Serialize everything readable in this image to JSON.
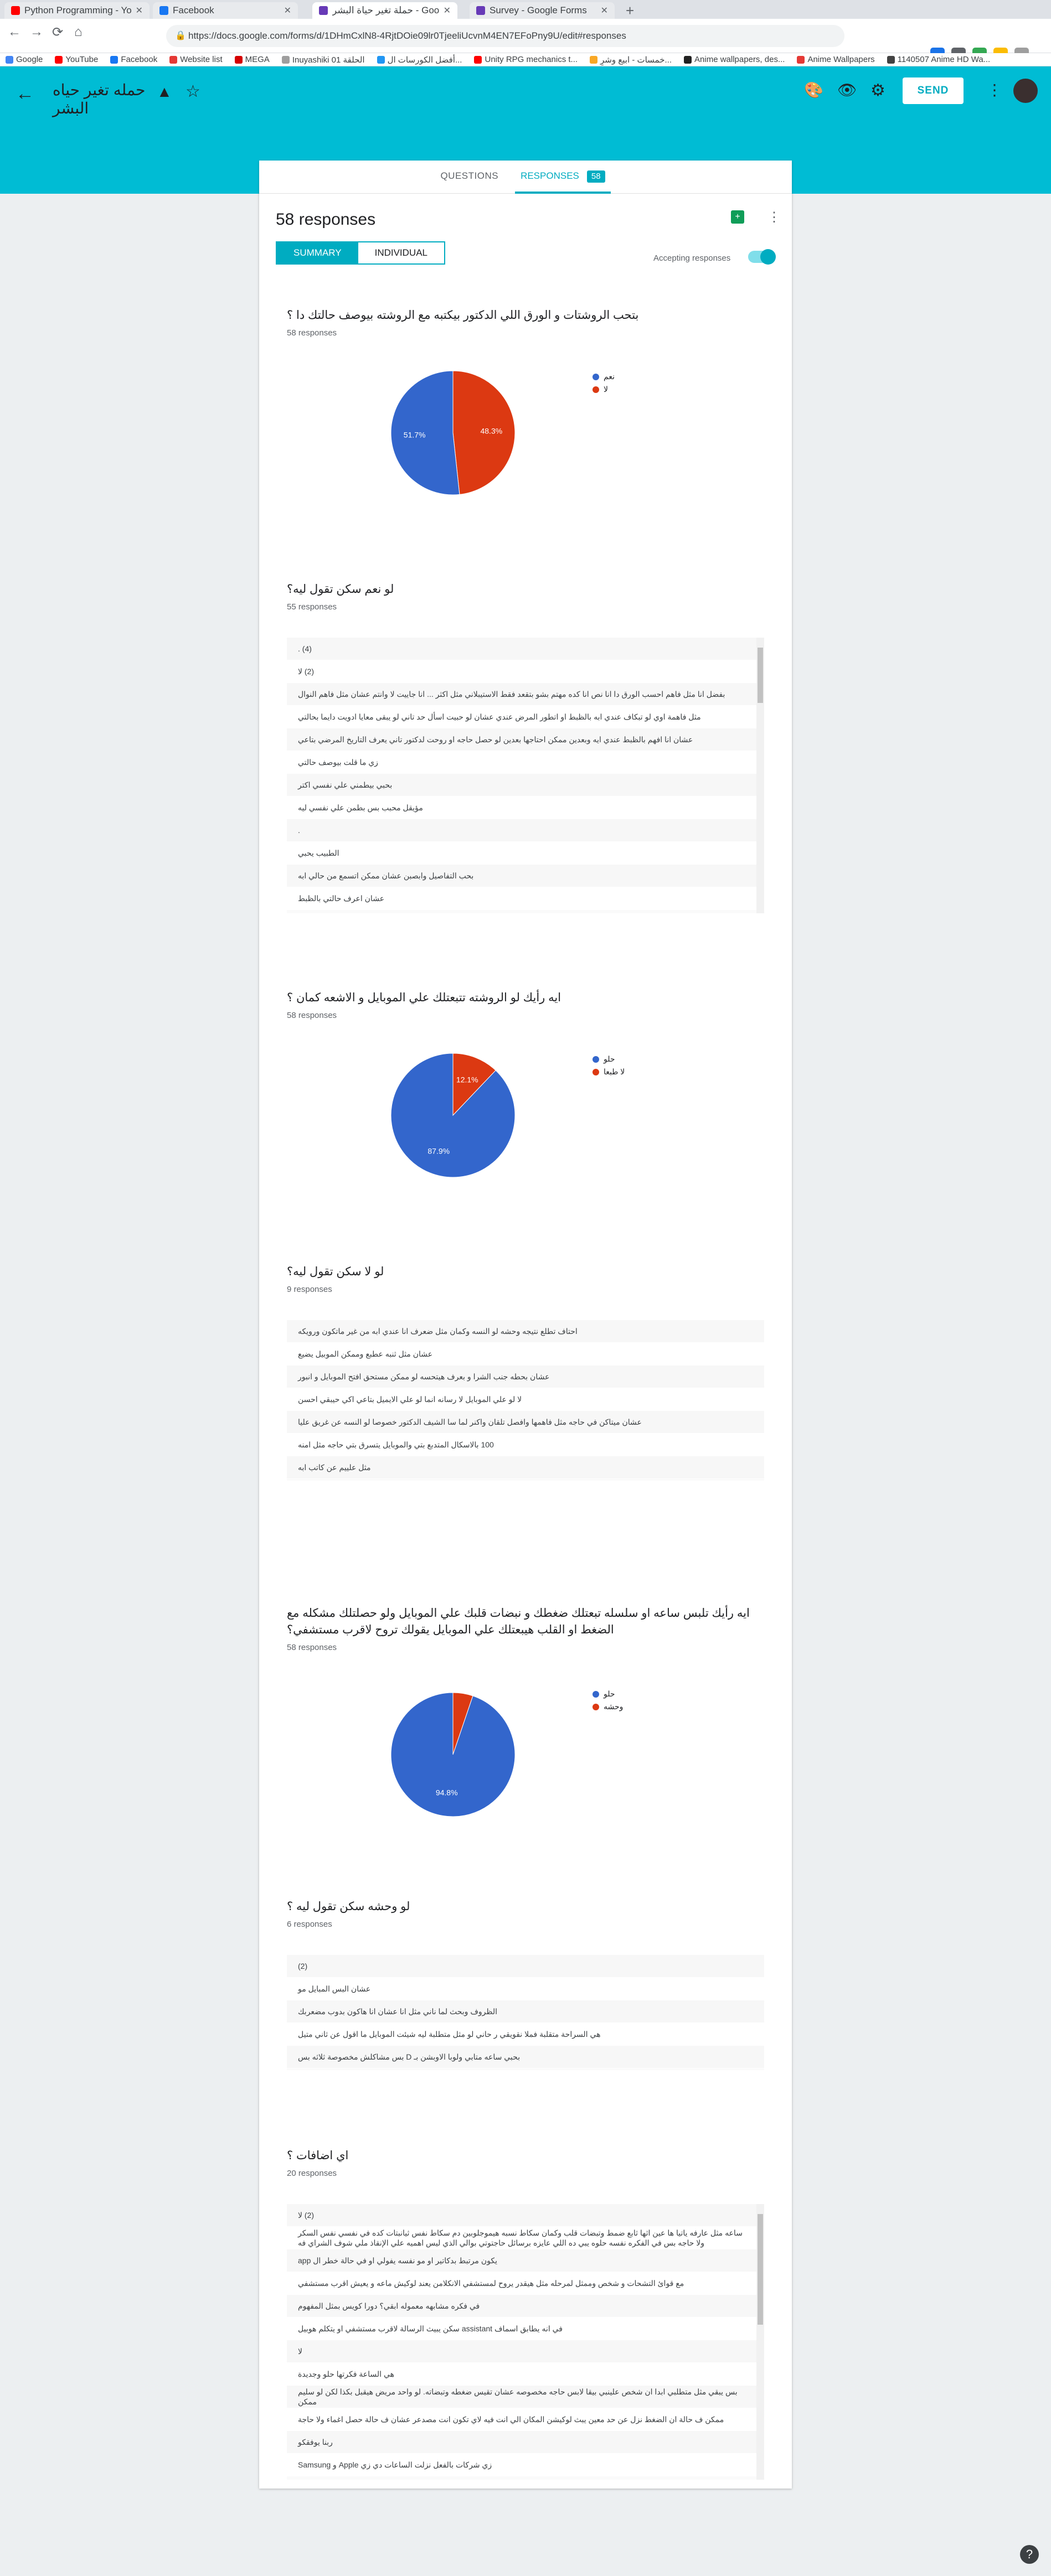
{
  "browser": {
    "tabs": [
      {
        "title": "Python Programming - YouTub",
        "color": "#ff0000"
      },
      {
        "title": "Facebook",
        "color": "#1877f2"
      },
      {
        "title": "حملة تغير حياة البشر - Google Forms",
        "color": "#673ab7"
      },
      {
        "title": "Survey - Google Forms",
        "color": "#673ab7"
      }
    ],
    "url": "https://docs.google.com/forms/d/1DHmCxlN8-4RjtDOie09lr0TjeeliUcvnM4EN7EFoPny9U/edit#responses",
    "bookmarks": [
      {
        "label": "Google",
        "color": "#4285f4"
      },
      {
        "label": "YouTube",
        "color": "#ff0000"
      },
      {
        "label": "Facebook",
        "color": "#1877f2"
      },
      {
        "label": "Website list",
        "color": "#e53935"
      },
      {
        "label": "MEGA",
        "color": "#d50000"
      },
      {
        "label": "Inuyashiki 01 الحلقة",
        "color": "#9e9e9e"
      },
      {
        "label": "أفضل الكورسات ال...",
        "color": "#2196f3"
      },
      {
        "label": "Unity RPG mechanics t...",
        "color": "#ff0000"
      },
      {
        "label": "خمسات - ابيع وشرِ...",
        "color": "#f9a825"
      },
      {
        "label": "Anime wallpapers, des...",
        "color": "#212121"
      },
      {
        "label": "Anime Wallpapers",
        "color": "#e53935"
      },
      {
        "label": "1140507 Anime HD Wa...",
        "color": "#424242"
      }
    ]
  },
  "appbar": {
    "form_title": "حمله تغير حياه البشر",
    "send_label": "SEND"
  },
  "tabs": {
    "questions": "QUESTIONS",
    "responses": "RESPONSES",
    "badge": "58"
  },
  "header": {
    "count_title": "58 responses",
    "summary": "SUMMARY",
    "individual": "INDIVIDUAL",
    "accepting": "Accepting responses"
  },
  "questions": [
    {
      "title": "بتحب الروشتات و الورق اللي الدكتور بيكتبه مع الروشته بيوصف حالتك دا ؟",
      "count": "58 responses"
    },
    {
      "title": "لو نعم سكن تقول ليه؟",
      "count": "55 responses"
    },
    {
      "title": "ايه رأيك لو الروشته تتبعتلك علي الموبايل و الاشعه كمان ؟",
      "count": "58 responses"
    },
    {
      "title": "لو لا سكن تقول ليه؟",
      "count": "9 responses"
    },
    {
      "title": "ايه رأيك تلبس ساعه او سلسله تبعتلك ضغطك و نبضات قلبك علي الموبايل ولو حصلتلك مشكله مع الضغط او القلب هيبعتلك علي الموبايل يقولك تروح لاقرب مستشفي؟",
      "count": "58 responses"
    },
    {
      "title": "لو وحشه سكن تقول ليه ؟",
      "count": "6 responses"
    },
    {
      "title": "اي اضافات ؟",
      "count": "20 responses"
    }
  ],
  "chart_data": [
    {
      "type": "pie",
      "labels": [
        "نعم",
        "لا"
      ],
      "values": [
        51.7,
        48.3
      ],
      "colors": [
        "#3366cc",
        "#dc3912"
      ]
    },
    {
      "type": "pie",
      "labels": [
        "حلو",
        "لا طبعا"
      ],
      "values": [
        87.9,
        12.1
      ],
      "colors": [
        "#3366cc",
        "#dc3912"
      ]
    },
    {
      "type": "pie",
      "labels": [
        "حلو",
        "وحشه"
      ],
      "values": [
        94.8,
        5.2
      ],
      "colors": [
        "#3366cc",
        "#dc3912"
      ]
    }
  ],
  "answers_q2": [
    "(4) .",
    "(2) لا",
    "بفضل انا مثل فاهم احسب الورق دا انا نص انا كده مهتم بشو بتقعد فقط الاستيبلاني مثل اكثر ... انا جاييت لا وانتم عشان مثل فاهم النوال",
    "مثل فاهمة اوي لو تبكاف عندي ابه بالظبط او اتطور المرض عندي عشان لو حبيت اسأل حد تاني لو يبقى معايا ادويت دايما بحالتي",
    "عشان انا افهم بالظبط عندي ايه وبعدين ممكن احتاجها بعدين لو حصل حاجه او روحت لدكتور تاني يعرف التاريخ المرضي بتاعي",
    "زي ما قلت بيوصف حالتي",
    "بحبي بيطمني علي نفسي اكتر",
    "مؤيقل محبب بس بطمن علي نفسي ليه",
    ".",
    "الطبيب يحبي",
    "بحب التفاصيل وابصبن عشان ممكن اتسمع من حالي ابه",
    "عشان اعرف حالتي بالظبط"
  ],
  "answers_q4": [
    "احتاف تطلع نتيجه وحشه لو النسه وكمان مثل ضعرف انا عندي ابه من غير ماتكون ورويكه",
    "عشان مثل ثنبه عطبع وممكن الموبيل يضيع",
    "عشان بحطه جنب الشرا و بعرف هيتحسه لو ممكن مستحق افتح الموبايل و انبور",
    "لا لو علي الموبايل لا رسانه انما لو علي الايميل بتاعي اكي حيبقي احسن",
    "عشان ميتاكن في حاجه مثل فاهمها وافصل تلقان واكنر لما سا الشيف الدكتور خصوصا لو النسه عن غريق عليا",
    "100 بالاسكال المتدبع بتي والموبايل يتسرق بتي حاجه مثل امنه",
    "مثل علييم عن كاتب ابه"
  ],
  "answers_q6": [
    "(2)",
    "عشان البس المبايل مو",
    "الظروف وبحث لما ناني مثل انا عشان انا هاكون بدوب مضعربك",
    "هي السراحة متقلبة فملا نقويقي ر حاني لو مثل متطلبة ليه شيئت الموبايل ما اقول عن ثاني متيل",
    "بحبي ساعه متابي ولوبا الاوبشن بـ D بس مشاكلش مخصوصة ثلاثه بس"
  ],
  "answers_q7": [
    "(2) لا",
    "ساعه مثل عارفه ياتيا ها عين اثها ثابع ضمط وتبضات قلب وكمان سكاط نسبه هيموجلوبين دم سكاط نفس ثيانبتات كده في نفسي نفس السكر ولا حاجه بس في الفكره نفسه حلوه يبي ده اللي عايزه برسائل حاجتوتي بوالي الذي ليس اهميه علي الإنقاذ ملي شوف الشراي فه",
    "يكون مرتبط بدكاتير او مو نفسه يفولي او في حالة خطر ال app",
    "مع قوائ التشحات و شخص وممثل لمرحله مثل هيقدر يروح لمستشفي الانكلامن يعند لوكيش ماعه و يعيش اقرب مستشفي",
    "في فكره مشابهه معموله ابقي؟ دورا كويس بمثل المفهوم",
    "في انه يطابق اسماف assistant سكن يبيث الرسالة لاقرب مستشفي او يتكلم هوبيل",
    "لا",
    "هي الساعة فكرتها حلو وجديدة",
    "بس يبقي مثل متطلبي ابدا ان شخص علينبي بيقا لابس حاجه مخصوصه عشان تقيس ضغطه وتبضاته. لو واحد مريض هيقبل بكذا لكن لو سليم ممكن",
    "ممكن ف حالة ان الضغط نزل عن حد معين يبث لوكيشن المكان الي انت فيه لاي تكون انت مصدعر عشان ف حالة حصل اغماء ولا حاجة",
    "ربنا يوفقكو",
    "زي شركات بالفعل نزلت الساعات دي زي Apple و Samsung"
  ]
}
